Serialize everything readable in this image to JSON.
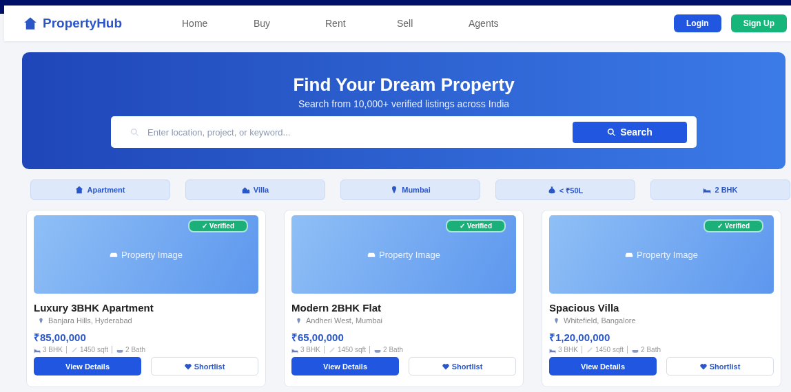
{
  "navbar": {
    "brand": "PropertyHub",
    "links": [
      "Home",
      "Buy",
      "Rent",
      "Sell",
      "Agents"
    ],
    "login": "Login",
    "signup": "Sign Up"
  },
  "hero": {
    "title": "Find Your Dream Property",
    "subtitle": "Search from 10,000+ verified listings across India",
    "search": {
      "placeholder": "Enter location, project, or keyword...",
      "button": "Search"
    }
  },
  "filters": [
    {
      "kind": "apartment",
      "label": "Apartment"
    },
    {
      "kind": "villa",
      "label": "Villa"
    },
    {
      "kind": "location",
      "label": "Mumbai"
    },
    {
      "kind": "budget",
      "label": "< ₹50L"
    },
    {
      "kind": "bedrooms",
      "label": "2 BHK"
    }
  ],
  "listings": [
    {
      "badge": "✓ Verified",
      "image_label": "Property Image",
      "title": "Luxury 3BHK Apartment",
      "location": "Banjara Hills, Hyderabad",
      "price": "₹85,00,000",
      "beds": "3 BHK",
      "area": "1450 sqft",
      "baths": "2 Bath",
      "primary": "View Details",
      "secondary": "Shortlist"
    },
    {
      "badge": "✓ Verified",
      "image_label": "Property Image",
      "title": "Modern 2BHK Flat",
      "location": "Andheri West, Mumbai",
      "price": "₹65,00,000",
      "beds": "3 BHK",
      "area": "1450 sqft",
      "baths": "2 Bath",
      "primary": "View Details",
      "secondary": "Shortlist"
    },
    {
      "badge": "✓ Verified",
      "image_label": "Property Image",
      "title": "Spacious Villa",
      "location": "Whitefield, Bangalore",
      "price": "₹1,20,00,000",
      "beds": "3 BHK",
      "area": "1450 sqft",
      "baths": "2 Bath",
      "primary": "View Details",
      "secondary": "Shortlist"
    }
  ]
}
